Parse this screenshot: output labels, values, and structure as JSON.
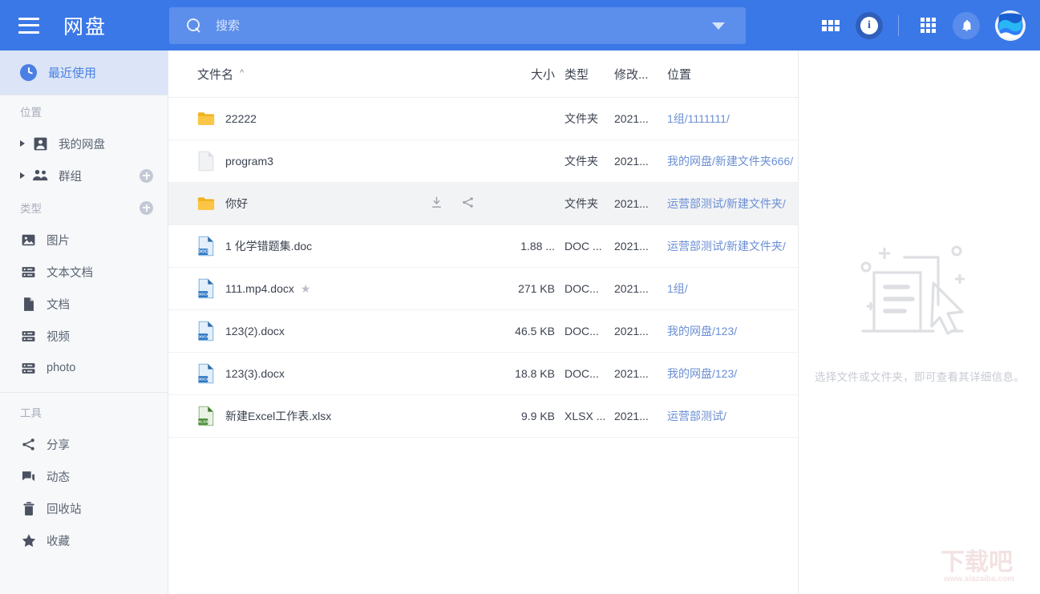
{
  "app": {
    "title": "网盘",
    "menu_icon": "hamburger-icon"
  },
  "search": {
    "placeholder": "搜索",
    "value": "",
    "icon": "search-icon",
    "dropdown_icon": "chevron-down-icon"
  },
  "topbar": {
    "view_grid_label": "grid-view-icon",
    "info_label": "i",
    "apps_label": "apps-grid-icon",
    "bell_label": "bell-icon",
    "avatar_label": "avatar"
  },
  "sidebar": {
    "active": {
      "label": "最近使用",
      "icon": "clock-icon"
    },
    "sections": [
      {
        "title": "位置",
        "has_add": false,
        "items": [
          {
            "label": "我的网盘",
            "icon": "user-icon",
            "expandable": true,
            "has_add": false
          },
          {
            "label": "群组",
            "icon": "group-icon",
            "expandable": true,
            "has_add": true
          }
        ]
      },
      {
        "title": "类型",
        "has_add": true,
        "items": [
          {
            "label": "图片",
            "icon": "image-icon",
            "expandable": false,
            "has_add": false
          },
          {
            "label": "文本文档",
            "icon": "textfile-icon",
            "expandable": false,
            "has_add": false
          },
          {
            "label": "文档",
            "icon": "document-icon",
            "expandable": false,
            "has_add": false
          },
          {
            "label": "视频",
            "icon": "video-icon",
            "expandable": false,
            "has_add": false
          },
          {
            "label": "photo",
            "icon": "photo-icon",
            "expandable": false,
            "has_add": false
          }
        ]
      },
      {
        "title": "工具",
        "has_add": false,
        "items": [
          {
            "label": "分享",
            "icon": "share-icon",
            "expandable": false,
            "has_add": false
          },
          {
            "label": "动态",
            "icon": "activity-icon",
            "expandable": false,
            "has_add": false
          },
          {
            "label": "回收站",
            "icon": "trash-icon",
            "expandable": false,
            "has_add": false
          },
          {
            "label": "收藏",
            "icon": "star-icon",
            "expandable": false,
            "has_add": false
          }
        ]
      }
    ]
  },
  "table": {
    "columns": {
      "name": "文件名",
      "sort_indicator": "^",
      "size": "大小",
      "type": "类型",
      "modified": "修改...",
      "location": "位置"
    },
    "rows": [
      {
        "name": "22222",
        "icon": "folder-icon",
        "size": "",
        "type": "文件夹",
        "modified": "2021...",
        "location": "1组/1111111/",
        "starred": false,
        "hovered": false
      },
      {
        "name": "program3",
        "icon": "blankfile-icon",
        "size": "",
        "type": "文件夹",
        "modified": "2021...",
        "location": "我的网盘/新建文件夹666/",
        "starred": false,
        "hovered": false
      },
      {
        "name": "你好",
        "icon": "folder-icon",
        "size": "",
        "type": "文件夹",
        "modified": "2021...",
        "location": "运营部测试/新建文件夹/",
        "starred": false,
        "hovered": true
      },
      {
        "name": "1 化学错题集.doc",
        "icon": "doc-icon",
        "size": "1.88 ...",
        "type": "DOC ...",
        "modified": "2021...",
        "location": "运营部测试/新建文件夹/",
        "starred": false,
        "hovered": false
      },
      {
        "name": "111.mp4.docx",
        "icon": "docx-icon",
        "size": "271 KB",
        "type": "DOC...",
        "modified": "2021...",
        "location": "1组/",
        "starred": true,
        "hovered": false
      },
      {
        "name": "123(2).docx",
        "icon": "docx-icon",
        "size": "46.5 KB",
        "type": "DOC...",
        "modified": "2021...",
        "location": "我的网盘/123/",
        "starred": false,
        "hovered": false
      },
      {
        "name": "123(3).docx",
        "icon": "docx-icon",
        "size": "18.8 KB",
        "type": "DOC...",
        "modified": "2021...",
        "location": "我的网盘/123/",
        "starred": false,
        "hovered": false
      },
      {
        "name": "新建Excel工作表.xlsx",
        "icon": "xlsx-icon",
        "size": "9.9 KB",
        "type": "XLSX ...",
        "modified": "2021...",
        "location": "运营部测试/",
        "starred": false,
        "hovered": false
      }
    ],
    "row_actions": [
      {
        "name": "download-icon"
      },
      {
        "name": "share-icon"
      }
    ]
  },
  "detail_panel": {
    "empty_text": "选择文件或文件夹，即可查看其详细信息。",
    "illustration": "document-cursor-illustration"
  },
  "watermark": {
    "text": "下载吧",
    "url": "www.xiazaiba.com"
  },
  "colors": {
    "brand_blue": "#3b78e7",
    "sidebar_bg": "#f7f8fa",
    "active_bg": "#dbe5f7",
    "active_text": "#4a7fe3",
    "link_blue": "#6b8fd4",
    "folder_yellow": "#f5c242",
    "doc_blue": "#4a90d9",
    "xlsx_green": "#5b9e4e"
  }
}
